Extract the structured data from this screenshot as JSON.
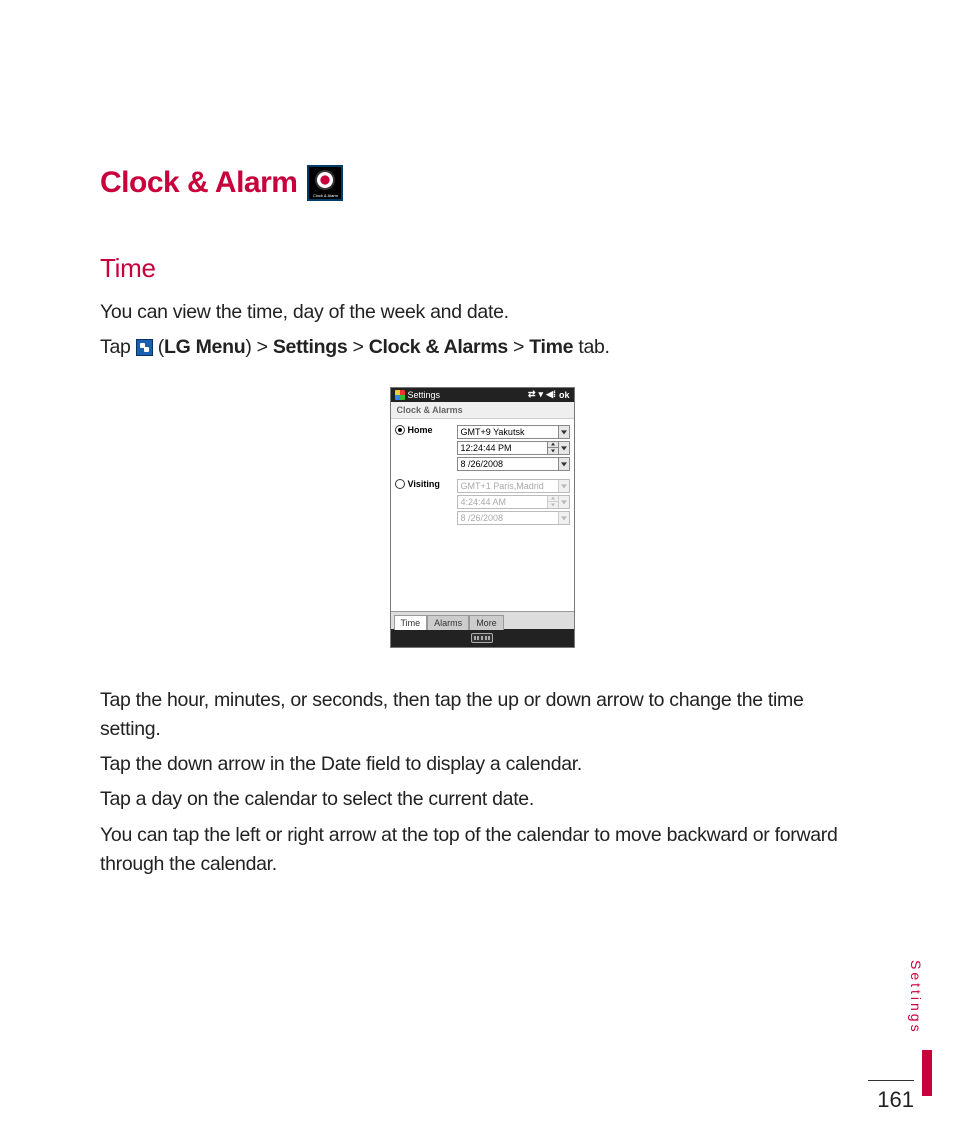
{
  "heading": "Clock & Alarm",
  "icon_label": "Clock & Alarm",
  "section_title": "Time",
  "intro": "You can view the time, day of the week and date.",
  "tap_prefix": "Tap ",
  "tap_open_paren": "(",
  "tap_lg_menu": "LG Menu",
  "tap_close_paren": ") > ",
  "tap_settings": "Settings",
  "tap_sep1": " > ",
  "tap_clock": "Clock & Alarms",
  "tap_sep2": " > ",
  "tap_time": "Time",
  "tap_tab_suffix": " tab.",
  "device": {
    "title": "Settings",
    "status_ok": "ok",
    "subtitle": "Clock & Alarms",
    "home": {
      "label": "Home",
      "tz": "GMT+9 Yakutsk",
      "time": "12:24:44 PM",
      "date": "8 /26/2008"
    },
    "visiting": {
      "label": "Visiting",
      "tz": "GMT+1 Paris,Madrid",
      "time": "4:24:44 AM",
      "date": "8 /26/2008"
    },
    "tabs": {
      "time": "Time",
      "alarms": "Alarms",
      "more": "More"
    }
  },
  "para1": "Tap the hour, minutes, or seconds, then tap the up or down arrow to change the time setting.",
  "para2": "Tap the down arrow in the Date field to display a calendar.",
  "para3": "Tap a day on the calendar to select the current date.",
  "para4": "You can tap the left or right arrow at the top of the calendar to move backward or forward through the calendar.",
  "side_label": "Settings",
  "page_number": "161"
}
